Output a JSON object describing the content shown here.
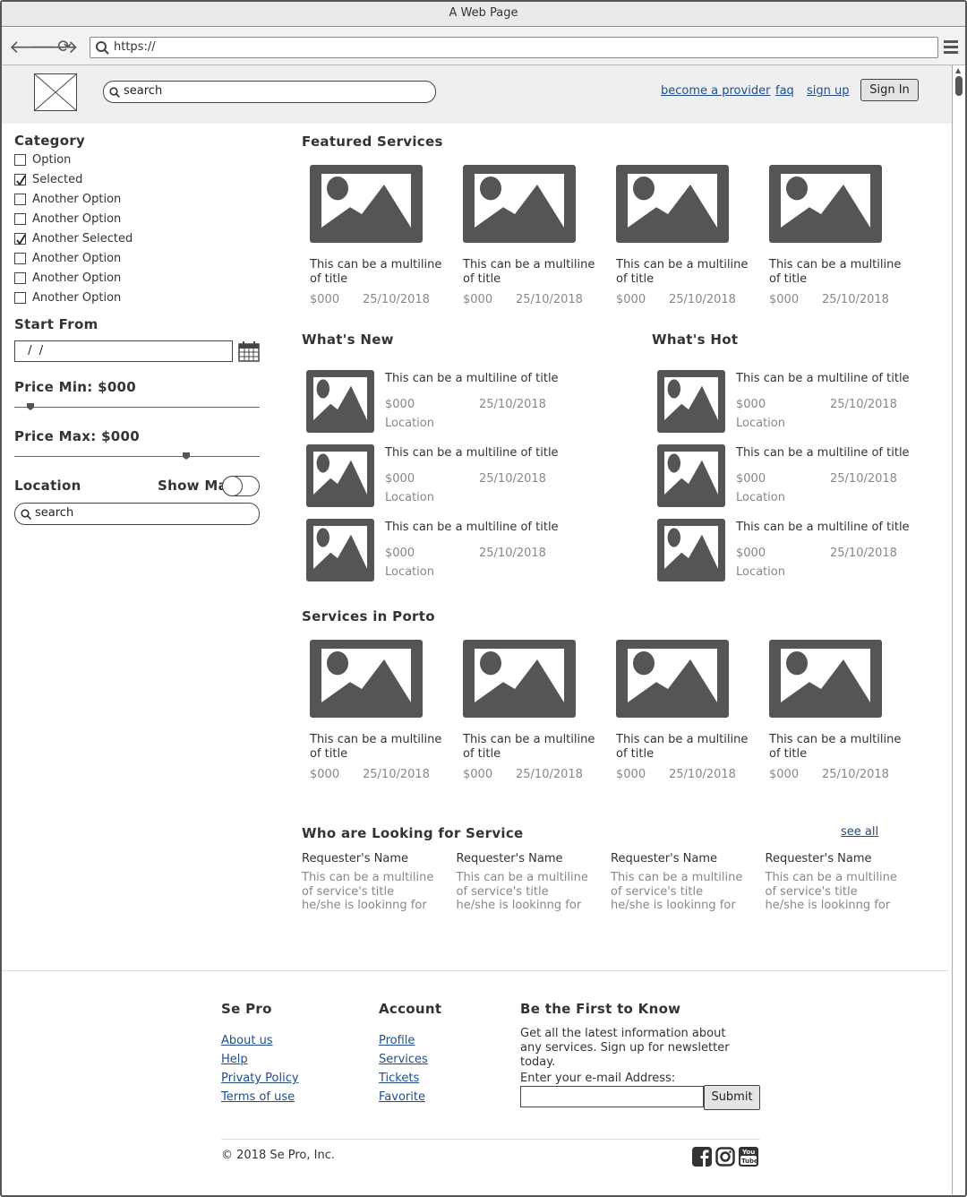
{
  "window": {
    "title": "A Web Page",
    "url": "https://"
  },
  "header": {
    "search_placeholder": "search",
    "links": [
      "become a provider",
      "faq",
      "sign up"
    ],
    "sign_in": "Sign In"
  },
  "sidebar": {
    "category_title": "Category",
    "options": [
      {
        "label": "Option",
        "checked": false
      },
      {
        "label": "Selected",
        "checked": true
      },
      {
        "label": "Another Option",
        "checked": false
      },
      {
        "label": "Another Option",
        "checked": false
      },
      {
        "label": "Another Selected",
        "checked": true
      },
      {
        "label": "Another Option",
        "checked": false
      },
      {
        "label": "Another Option",
        "checked": false
      },
      {
        "label": "Another Option",
        "checked": false
      }
    ],
    "start_from_title": "Start From",
    "date_value": " /  /",
    "price_min_label": "Price Min: $000",
    "price_max_label": "Price Max: $000",
    "location_title": "Location",
    "show_map_label": "Show Map",
    "location_search": "search"
  },
  "featured": {
    "title": "Featured Services",
    "cards": [
      {
        "title": "This can be a multiline of title",
        "price": "$000",
        "date": "25/10/2018"
      },
      {
        "title": "This can be a multiline of title",
        "price": "$000",
        "date": "25/10/2018"
      },
      {
        "title": "This can be a multiline of title",
        "price": "$000",
        "date": "25/10/2018"
      },
      {
        "title": "This can be a multiline of title",
        "price": "$000",
        "date": "25/10/2018"
      }
    ]
  },
  "whats_new": {
    "title": "What's New",
    "items": [
      {
        "title": "This can be a multiline of title",
        "price": "$000",
        "date": "25/10/2018",
        "location": "Location"
      },
      {
        "title": "This can be a multiline of title",
        "price": "$000",
        "date": "25/10/2018",
        "location": "Location"
      },
      {
        "title": "This can be a multiline of title",
        "price": "$000",
        "date": "25/10/2018",
        "location": "Location"
      }
    ]
  },
  "whats_hot": {
    "title": "What's Hot",
    "items": [
      {
        "title": "This can be a multiline of title",
        "price": "$000",
        "date": "25/10/2018",
        "location": "Location"
      },
      {
        "title": "This can be a multiline of title",
        "price": "$000",
        "date": "25/10/2018",
        "location": "Location"
      },
      {
        "title": "This can be a multiline of title",
        "price": "$000",
        "date": "25/10/2018",
        "location": "Location"
      }
    ]
  },
  "porto": {
    "title": "Services in Porto",
    "cards": [
      {
        "title": "This can be a multiline of title",
        "price": "$000",
        "date": "25/10/2018"
      },
      {
        "title": "This can be a multiline of title",
        "price": "$000",
        "date": "25/10/2018"
      },
      {
        "title": "This can be a multiline of title",
        "price": "$000",
        "date": "25/10/2018"
      },
      {
        "title": "This can be a multiline of title",
        "price": "$000",
        "date": "25/10/2018"
      }
    ]
  },
  "looking": {
    "title": "Who are Looking for Service",
    "see_all": "see all",
    "requests": [
      {
        "name": "Requester's Name",
        "text": "This can be a multiline of service's title he/she is lookinng for"
      },
      {
        "name": "Requester's Name",
        "text": "This can be a multiline of service's title he/she is lookinng for"
      },
      {
        "name": "Requester's Name",
        "text": "This can be a multiline of service's title he/she is lookinng for"
      },
      {
        "name": "Requester's Name",
        "text": "This can be a multiline of service's title he/she is lookinng for"
      }
    ]
  },
  "footer": {
    "col1_title": "Se Pro",
    "col1_links": [
      "About us",
      "Help",
      "Privaty Policy",
      "Terms of use"
    ],
    "col2_title": "Account",
    "col2_links": [
      "Profile",
      "Services",
      "Tickets",
      "Favorite"
    ],
    "news_title": "Be the First to Know",
    "news_text": "Get all the latest information about any services. Sign up for newsletter today.",
    "email_label": "Enter your e-mail Address:",
    "submit": "Submit",
    "copyright": "© 2018 Se Pro, Inc.",
    "social_icons": [
      "facebook-icon",
      "instagram-icon",
      "youtube-icon"
    ]
  }
}
